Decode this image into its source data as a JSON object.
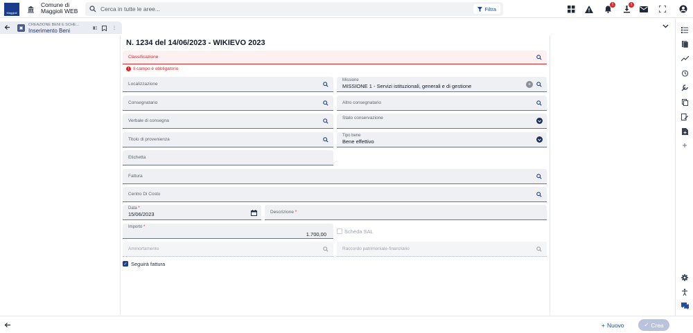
{
  "header": {
    "logo_text": "Maggioli",
    "app_title_line1": "Comune di",
    "app_title_line2": "Maggioli WEB",
    "search_placeholder": "Cerca in tutte le aree...",
    "filter_label": "Filtra",
    "notification_count": "1",
    "download_count": "1"
  },
  "tab": {
    "breadcrumb": "CREAZIONE BENI E SCHE...",
    "title": "Inserimento Beni"
  },
  "form": {
    "title": "N. 1234 del 14/06/2023 - WIKIEVO 2023",
    "classificazione_label": "Classificazione",
    "required_error": "Il campo è obbligatorio",
    "localizzazione_label": "Localizzazione",
    "missione_label": "Missione",
    "missione_value": "MISSIONE 1 - Servizi istituzionali, generali e di gestione",
    "consegnatario_label": "Consegnatario",
    "altro_consegnatario_label": "Altro consegnatario",
    "verbale_label": "Verbale di consegna",
    "stato_conservazione_label": "Stato conservazione",
    "titolo_provenienza_label": "Titolo di provenienza",
    "tipo_bene_label": "Tipo bene",
    "tipo_bene_value": "Bene effettivo",
    "etichetta_label": "Etichetta",
    "fattura_label": "Fattura",
    "centro_costo_label": "Centro Di Costo",
    "data_label": "Data",
    "data_value": "15/06/2023",
    "descrizione_label": "Descrizione",
    "importo_label": "Importo",
    "importo_value": "1.700,00",
    "scheda_sal_label": "Scheda SAL",
    "ammortamento_label": "Ammortamento",
    "raccordo_label": "Raccordo patrimoniale-finanziario",
    "seguira_fattura_label": "Seguirà fattura",
    "required_marker": "*"
  },
  "footer": {
    "nuovo_label": "Nuovo",
    "crea_label": "Crea"
  },
  "colors": {
    "primary": "#1f3f8b",
    "error": "#d62828",
    "field_bg": "#eef0f3"
  }
}
